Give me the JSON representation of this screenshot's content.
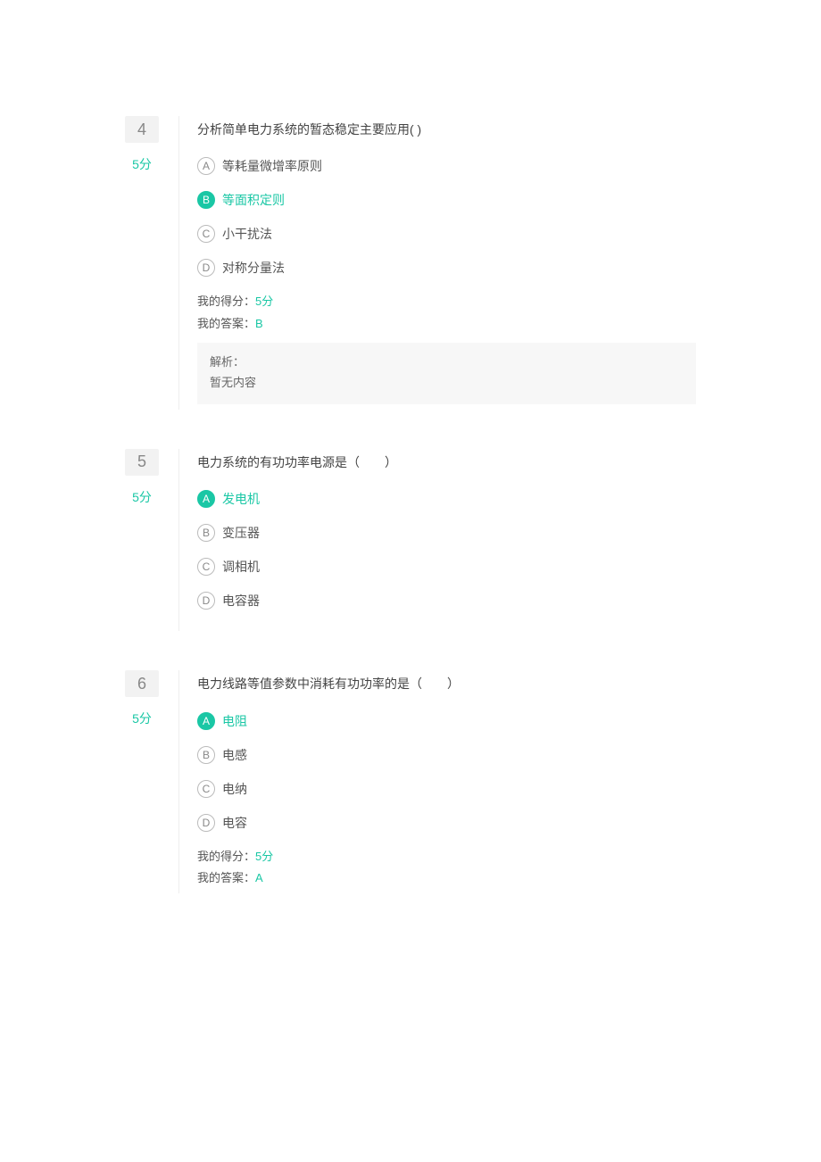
{
  "questions": [
    {
      "number": "4",
      "points": "5分",
      "text": "分析简单电力系统的暂态稳定主要应用(  )",
      "options": [
        {
          "letter": "A",
          "text": "等耗量微增率原则",
          "correct": false
        },
        {
          "letter": "B",
          "text": "等面积定则",
          "correct": true
        },
        {
          "letter": "C",
          "text": "小干扰法",
          "correct": false
        },
        {
          "letter": "D",
          "text": "对称分量法",
          "correct": false
        }
      ],
      "my_score_label": "我的得分：",
      "my_score_value": "5分",
      "my_answer_label": "我的答案：",
      "my_answer_value": "B",
      "analysis_label": "解析：",
      "analysis_text": "暂无内容",
      "show_score": true,
      "show_analysis": true
    },
    {
      "number": "5",
      "points": "5分",
      "text": "电力系统的有功功率电源是（　　）",
      "options": [
        {
          "letter": "A",
          "text": "发电机",
          "correct": true
        },
        {
          "letter": "B",
          "text": "变压器",
          "correct": false
        },
        {
          "letter": "C",
          "text": "调相机",
          "correct": false
        },
        {
          "letter": "D",
          "text": "电容器",
          "correct": false
        }
      ],
      "show_score": false,
      "show_analysis": false
    },
    {
      "number": "6",
      "points": "5分",
      "text": "电力线路等值参数中消耗有功功率的是（　　）",
      "options": [
        {
          "letter": "A",
          "text": "电阻",
          "correct": true
        },
        {
          "letter": "B",
          "text": "电感",
          "correct": false
        },
        {
          "letter": "C",
          "text": "电纳",
          "correct": false
        },
        {
          "letter": "D",
          "text": "电容",
          "correct": false
        }
      ],
      "my_score_label": "我的得分：",
      "my_score_value": "5分",
      "my_answer_label": "我的答案：",
      "my_answer_value": "A",
      "show_score": true,
      "show_analysis": false
    }
  ]
}
